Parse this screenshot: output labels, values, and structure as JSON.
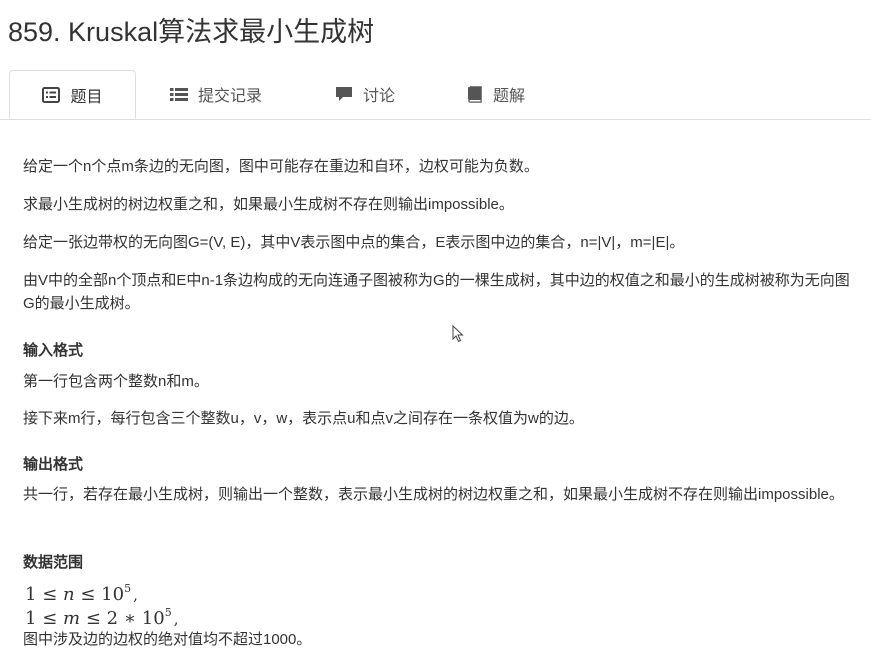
{
  "problem": {
    "title": "859. Kruskal算法求最小生成树"
  },
  "tabs": [
    {
      "label": "题目",
      "icon": "list-alt-icon",
      "active": true
    },
    {
      "label": "提交记录",
      "icon": "list-icon",
      "active": false
    },
    {
      "label": "讨论",
      "icon": "comment-icon",
      "active": false
    },
    {
      "label": "题解",
      "icon": "book-icon",
      "active": false
    }
  ],
  "statement": {
    "p1": "给定一个n个点m条边的无向图，图中可能存在重边和自环，边权可能为负数。",
    "p2": "求最小生成树的树边权重之和，如果最小生成树不存在则输出impossible。",
    "p3": "给定一张边带权的无向图G=(V, E)，其中V表示图中点的集合，E表示图中边的集合，n=|V|，m=|E|。",
    "p4": "由V中的全部n个顶点和E中n-1条边构成的无向连通子图被称为G的一棵生成树，其中边的权值之和最小的生成树被称为无向图G的最小生成树。"
  },
  "input_format": {
    "heading": "输入格式",
    "line1": "第一行包含两个整数n和m。",
    "line2": "接下来m行，每行包含三个整数u，v，w，表示点u和点v之间存在一条权值为w的边。"
  },
  "output_format": {
    "heading": "输出格式",
    "text": "共一行，若存在最小生成树，则输出一个整数，表示最小生成树的树边权重之和，如果最小生成树不存在则输出impossible。"
  },
  "data_range": {
    "heading": "数据范围",
    "range1": {
      "lhs": "1",
      "le1": "≤",
      "var": "n",
      "le2": "≤",
      "base": "10",
      "exp": "5",
      "tail": ","
    },
    "range2": {
      "lhs": "1",
      "le1": "≤",
      "var": "m",
      "le2": "≤",
      "mult": "2 ∗ 10",
      "exp": "5",
      "tail": ","
    },
    "note": "图中涉及边的边权的绝对值均不超过1000。"
  }
}
